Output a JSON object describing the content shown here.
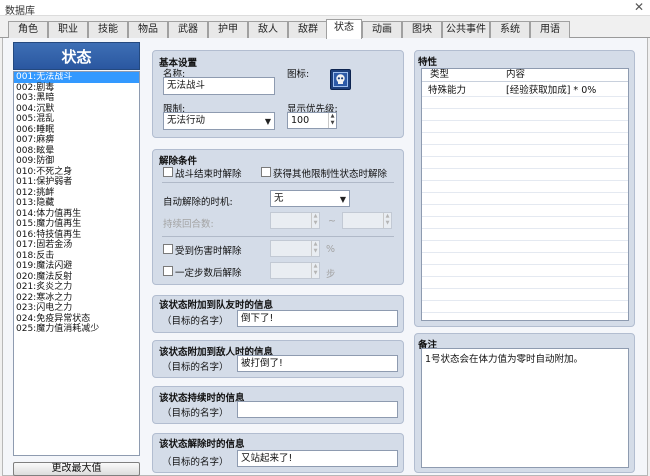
{
  "window": {
    "title": "数据库",
    "close_glyph": "✕"
  },
  "tabs": [
    {
      "label": "角色"
    },
    {
      "label": "职业"
    },
    {
      "label": "技能"
    },
    {
      "label": "物品"
    },
    {
      "label": "武器"
    },
    {
      "label": "护甲"
    },
    {
      "label": "敌人"
    },
    {
      "label": "敌群"
    },
    {
      "label": "状态"
    },
    {
      "label": "动画"
    },
    {
      "label": "图块"
    },
    {
      "label": "公共事件"
    },
    {
      "label": "系统"
    },
    {
      "label": "用语"
    }
  ],
  "state_list": {
    "header": "状态",
    "selected_index": 0,
    "items": [
      "001:无法战斗",
      "002:剧毒",
      "003:黑暗",
      "004:沉默",
      "005:混乱",
      "006:睡眠",
      "007:麻痹",
      "008:眩晕",
      "009:防御",
      "010:不死之身",
      "011:保护弱者",
      "012:挑衅",
      "013:隐藏",
      "014:体力值再生",
      "015:魔力值再生",
      "016:特技值再生",
      "017:固若金汤",
      "018:反击",
      "019:魔法闪避",
      "020:魔法反射",
      "021:炙炎之力",
      "022:寒冰之力",
      "023:闪电之力",
      "024:免疫异常状态",
      "025:魔力值消耗减少"
    ],
    "max_button_label": "更改最大值"
  },
  "basic": {
    "title": "基本设置",
    "name_label": "名称:",
    "name_value": "无法战斗",
    "icon_label": "图标:",
    "icon_name": "skull-icon",
    "restriction_label": "限制:",
    "restriction_value": "无法行动",
    "priority_label": "显示优先级:",
    "priority_value": "100"
  },
  "removal": {
    "title": "解除条件",
    "remove_at_battle_end": "战斗结束时解除",
    "remove_by_restriction": "获得其他限制性状态时解除",
    "auto_removal_label": "自动解除的时机:",
    "auto_removal_value": "无",
    "duration_label": "持续回合数:",
    "range_separator": "~",
    "remove_by_damage": "受到伤害时解除",
    "percent_unit": "%",
    "remove_by_walking": "一定步数后解除",
    "steps_unit": "步"
  },
  "messages": {
    "target_name_label": "（目标的名字）",
    "actor": {
      "title": "该状态附加到队友时的信息",
      "value": "倒下了!"
    },
    "enemy": {
      "title": "该状态附加到敌人时的信息",
      "value": "被打倒了!"
    },
    "persist": {
      "title": "该状态持续时的信息",
      "value": ""
    },
    "remove": {
      "title": "该状态解除时的信息",
      "value": "又站起来了!"
    }
  },
  "traits": {
    "title": "特性",
    "columns": [
      "类型",
      "内容"
    ],
    "rows": [
      {
        "type": "特殊能力",
        "content": "[经验获取加成] * 0%"
      }
    ]
  },
  "note": {
    "title": "备注",
    "text": "1号状态会在体力值为零时自动附加。"
  },
  "colors": {
    "list_header": "#2f5fa8",
    "selection": "#3399ff",
    "panel": "#d4dce8"
  }
}
